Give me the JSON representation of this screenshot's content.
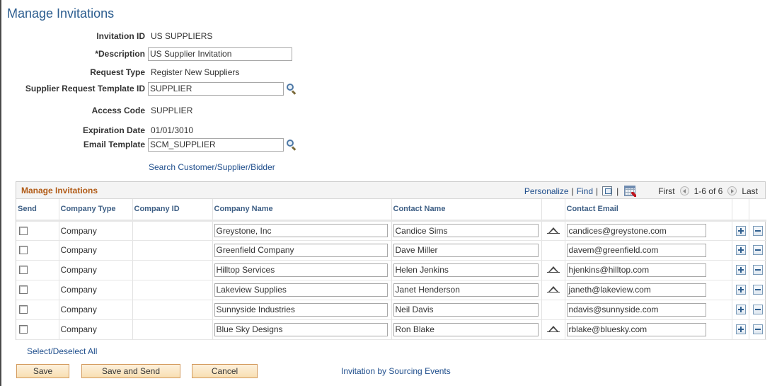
{
  "page": {
    "title": "Manage Invitations"
  },
  "form": {
    "invitation_id_label": "Invitation ID",
    "invitation_id_value": "US SUPPLIERS",
    "description_label": "*Description",
    "description_value": "US Supplier Invitation",
    "request_type_label": "Request Type",
    "request_type_value": "Register New Suppliers",
    "template_id_label": "Supplier Request Template ID",
    "template_id_value": "SUPPLIER",
    "access_code_label": "Access Code",
    "access_code_value": "SUPPLIER",
    "expiration_label": "Expiration Date",
    "expiration_value": "01/01/3010",
    "email_template_label": "Email Template",
    "email_template_value": "SCM_SUPPLIER",
    "search_link": "Search Customer/Supplier/Bidder"
  },
  "grid": {
    "title": "Manage Invitations",
    "personalize": "Personalize",
    "find": "Find",
    "separator": "|",
    "first": "First",
    "range": "1-6 of 6",
    "last": "Last",
    "columns": {
      "send": "Send",
      "company_type": "Company Type",
      "company_id": "Company ID",
      "company_name": "Company Name",
      "contact_name": "Contact Name",
      "address": "",
      "contact_email": "Contact Email"
    },
    "rows": [
      {
        "send": false,
        "company_type": "Company",
        "company_id": "",
        "company_name": "Greystone, Inc",
        "contact_name": "Candice Sims",
        "has_address_icon": true,
        "contact_email": "candices@greystone.com"
      },
      {
        "send": false,
        "company_type": "Company",
        "company_id": "",
        "company_name": "Greenfield Company",
        "contact_name": "Dave Miller",
        "has_address_icon": false,
        "contact_email": "davem@greenfield.com"
      },
      {
        "send": false,
        "company_type": "Company",
        "company_id": "",
        "company_name": "Hilltop Services",
        "contact_name": "Helen Jenkins",
        "has_address_icon": true,
        "contact_email": "hjenkins@hilltop.com"
      },
      {
        "send": false,
        "company_type": "Company",
        "company_id": "",
        "company_name": "Lakeview Supplies",
        "contact_name": "Janet Henderson",
        "has_address_icon": true,
        "contact_email": "janeth@lakeview.com"
      },
      {
        "send": false,
        "company_type": "Company",
        "company_id": "",
        "company_name": "Sunnyside Industries",
        "contact_name": "Neil Davis",
        "has_address_icon": false,
        "contact_email": "ndavis@sunnyside.com"
      },
      {
        "send": false,
        "company_type": "Company",
        "company_id": "",
        "company_name": "Blue Sky Designs",
        "contact_name": "Ron Blake",
        "has_address_icon": true,
        "contact_email": "rblake@bluesky.com"
      }
    ]
  },
  "footer": {
    "select_all": "Select/Deselect All",
    "save": "Save",
    "save_and_send": "Save and Send",
    "cancel": "Cancel",
    "invitation_link": "Invitation by Sourcing Events"
  },
  "icons": {
    "lookup": "magnifier-icon",
    "zoom": "new-window-icon",
    "download": "download-to-spreadsheet-icon",
    "address": "address-triangle-icon",
    "add_row": "plus-icon",
    "delete_row": "minus-icon"
  },
  "colors": {
    "title": "#2c5d8f",
    "grid_title": "#b15b16",
    "link": "#1f4e8c",
    "button_bg": "#f8dfb2"
  }
}
